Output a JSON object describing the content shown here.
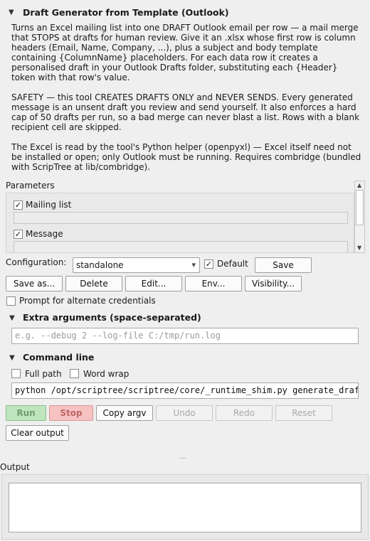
{
  "header": {
    "title": "Draft Generator from Template (Outlook)"
  },
  "description": {
    "paragraph1": "Turns an Excel mailing list into one DRAFT Outlook email per row — a mail merge that STOPS at drafts for human review. Give it an .xlsx whose first row is column headers (Email, Name, Company, ...), plus a subject and body template containing {ColumnName} placeholders. For each data row it creates a personalised draft in your Outlook Drafts folder, substituting each {Header} token with that row's value.",
    "paragraph2": "SAFETY — this tool CREATES DRAFTS ONLY and NEVER SENDS. Every generated message is an unsent draft you review and send yourself. It also enforces a hard cap of 50 drafts per run, so a bad merge can never blast a list. Rows with a blank recipient cell are skipped.",
    "paragraph3": "The Excel is read by the tool's Python helper (openpyxl) — Excel itself need not be installed or open; only Outlook must be running. Requires combridge (bundled with ScripTree at lib/combridge)."
  },
  "parameters": {
    "label": "Parameters",
    "items": [
      {
        "label": "Mailing list",
        "checked": true,
        "value": ""
      },
      {
        "label": "Message",
        "checked": true,
        "value": ""
      }
    ]
  },
  "configuration": {
    "label": "Configuration:",
    "selected": "standalone",
    "default_label": "Default",
    "default_checked": true,
    "save_label": "Save"
  },
  "config_buttons": {
    "save_as": "Save as...",
    "delete": "Delete",
    "edit": "Edit...",
    "env": "Env...",
    "visibility": "Visibility..."
  },
  "prompt_credentials": {
    "label": "Prompt for alternate credentials",
    "checked": false
  },
  "extra_args": {
    "title": "Extra arguments (space-separated)",
    "placeholder": "e.g. --debug 2 --log-file C:/tmp/run.log",
    "value": ""
  },
  "command_line": {
    "title": "Command line",
    "full_path_label": "Full path",
    "word_wrap_label": "Word wrap",
    "value": "python /opt/scriptree/scriptree/core/_runtime_shim.py generate_drafts"
  },
  "actions": {
    "run": "Run",
    "stop": "Stop",
    "copy_argv": "Copy argv",
    "undo": "Undo",
    "redo": "Redo",
    "reset": "Reset",
    "clear_output": "Clear output"
  },
  "splitter": {
    "grip": "....."
  },
  "output": {
    "label": "Output",
    "text": ""
  },
  "icons": {
    "collapse": "▼",
    "check": "✓",
    "dropdown": "▾",
    "scroll_up": "▲",
    "scroll_down": "▼"
  }
}
